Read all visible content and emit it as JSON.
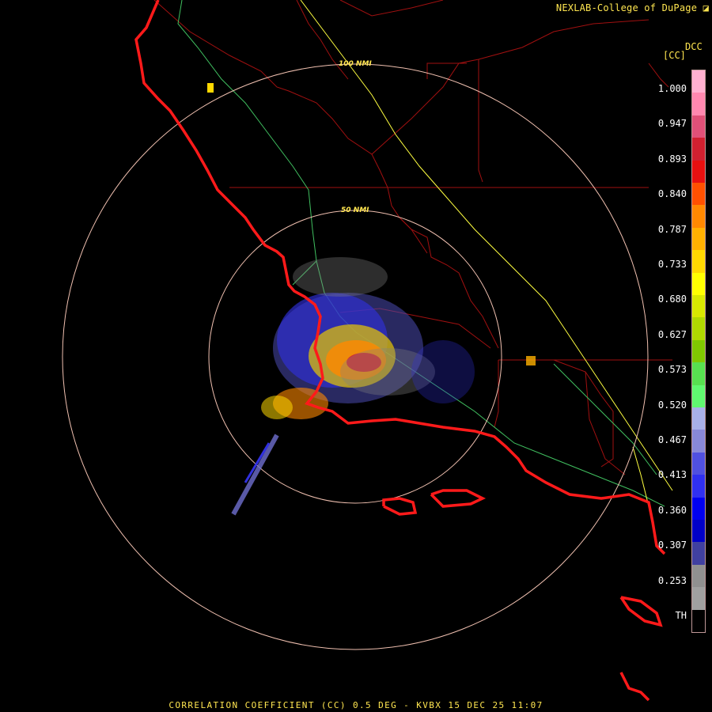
{
  "credit": "NEXLAB-College of DuPage",
  "product_code": "DCC",
  "product_abbrev": "[CC]",
  "footer": "CORRELATION COEFFICIENT (CC) 0.5 DEG - KVBX 15 DEC 25 11:07",
  "rings": [
    {
      "label": "100 NMI",
      "range_nmi": 100
    },
    {
      "label": "50 NMI",
      "range_nmi": 50
    }
  ],
  "legend": {
    "tick_labels": [
      "1.000",
      "0.947",
      "0.893",
      "0.840",
      "0.787",
      "0.733",
      "0.680",
      "0.627",
      "0.573",
      "0.520",
      "0.467",
      "0.413",
      "0.360",
      "0.307",
      "0.253",
      "TH"
    ],
    "colors": [
      "#ffb0d0",
      "#ff88b0",
      "#e05078",
      "#d02030",
      "#e81010",
      "#ff5000",
      "#ff8800",
      "#ffb000",
      "#ffd800",
      "#ffff00",
      "#d8e800",
      "#b0d800",
      "#80c800",
      "#58e050",
      "#60f870",
      "#a8b0e8",
      "#8888d8",
      "#5050e0",
      "#3030f0",
      "#0000f0",
      "#0000c8",
      "#4040a0",
      "#909090",
      "#a0a0a0",
      "#000000"
    ]
  },
  "colors": {
    "coastline": "#ff1a1a",
    "county_lines": "#a01010",
    "highways": "#40c060",
    "interstate": "#ffff40",
    "range_rings": "#f0c0b0",
    "text": "#ffe650"
  }
}
